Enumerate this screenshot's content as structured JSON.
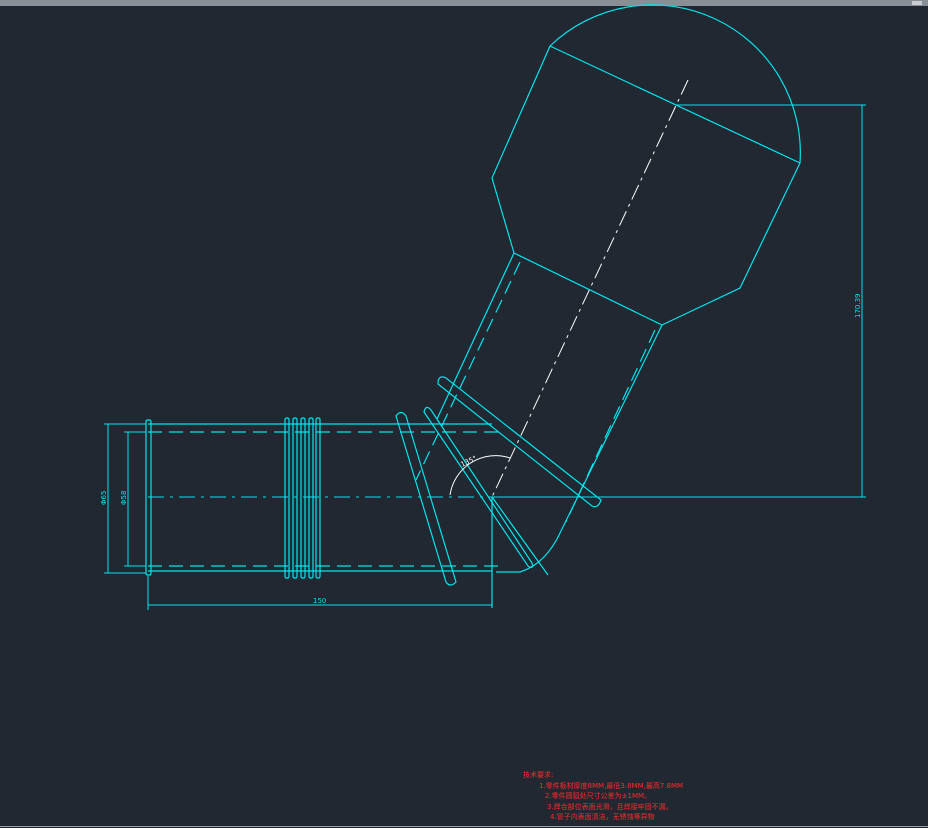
{
  "drawing": {
    "dimensions": {
      "length_150": "150",
      "dia_outer": "Φ65",
      "dia_inner": "Φ58",
      "angle": "135°",
      "height": "170.39"
    },
    "notes": {
      "title": "技术要求:",
      "items": [
        "1.零件板材厚度8MM,最低3.8MM,最高7.8MM",
        "2.零件圆弧处尺寸公差为±1MM。",
        "3.焊合部位表面光滑，且焊接牢固不漏。",
        "4.管子内表面清洁，无锈蚀等异物"
      ]
    },
    "colors": {
      "background": "#222831",
      "geometry": "#00e5ee",
      "centerline": "#ffffff",
      "notes": "#ff2a2a"
    }
  }
}
